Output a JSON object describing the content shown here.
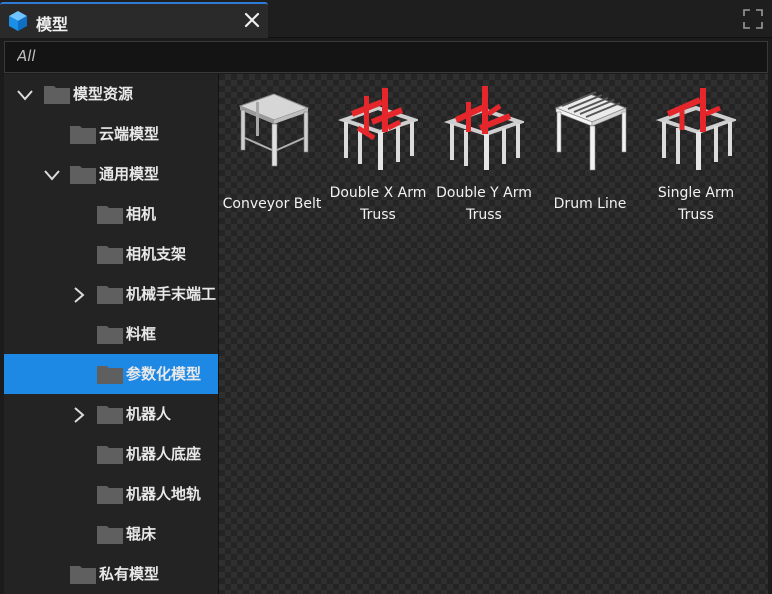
{
  "window": {
    "tab_title": "模型",
    "colors": {
      "accent": "#2e7cd6",
      "selected": "#1e88e5",
      "truss_red": "#e5262b"
    }
  },
  "search": {
    "value": "All"
  },
  "sidebar": {
    "items": [
      {
        "label": "模型资源",
        "expanded": true
      },
      {
        "label": "云端模型"
      },
      {
        "label": "通用模型",
        "expanded": true
      },
      {
        "label": "相机"
      },
      {
        "label": "相机支架"
      },
      {
        "label": "机械手末端工",
        "collapsed": true
      },
      {
        "label": "料框"
      },
      {
        "label": "参数化模型",
        "selected": true
      },
      {
        "label": "机器人",
        "collapsed": true
      },
      {
        "label": "机器人底座"
      },
      {
        "label": "机器人地轨"
      },
      {
        "label": "辊床"
      },
      {
        "label": "私有模型"
      }
    ]
  },
  "models": [
    {
      "label": "Conveyor Belt",
      "icon": "conveyor-belt-icon"
    },
    {
      "label": "Double X Arm Truss",
      "icon": "double-x-arm-truss-icon"
    },
    {
      "label": "Double Y Arm Truss",
      "icon": "double-y-arm-truss-icon"
    },
    {
      "label": "Drum Line",
      "icon": "drum-line-icon"
    },
    {
      "label": "Single Arm Truss",
      "icon": "single-arm-truss-icon"
    }
  ]
}
